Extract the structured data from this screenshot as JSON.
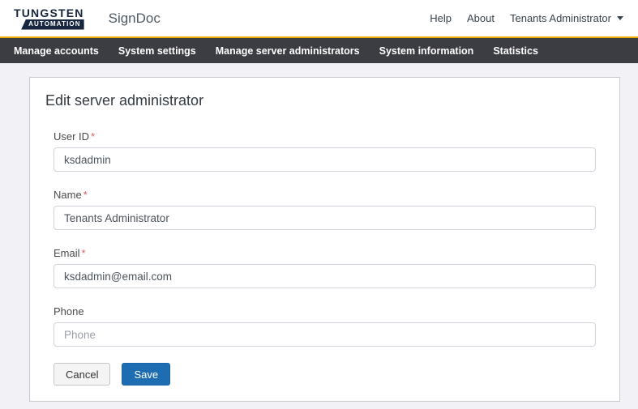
{
  "brand": {
    "logo_line1": "TUNGSTEN",
    "logo_line2": "AUTOMATION",
    "app_name": "SignDoc"
  },
  "header": {
    "links": [
      {
        "label": "Help"
      },
      {
        "label": "About"
      }
    ],
    "user_menu": {
      "label": "Tenants Administrator"
    }
  },
  "nav": {
    "items": [
      "Manage accounts",
      "System settings",
      "Manage server administrators",
      "System information",
      "Statistics"
    ]
  },
  "main": {
    "title": "Edit server administrator",
    "fields": [
      {
        "label": "User ID",
        "required_mark": "*",
        "value": "ksdadmin",
        "placeholder": ""
      },
      {
        "label": "Name",
        "required_mark": "*",
        "value": "Tenants Administrator",
        "placeholder": ""
      },
      {
        "label": "Email",
        "required_mark": "*",
        "value": "ksdadmin@email.com",
        "placeholder": ""
      },
      {
        "label": "Phone",
        "required_mark": "",
        "value": "",
        "placeholder": "Phone"
      }
    ],
    "buttons": {
      "cancel": "Cancel",
      "save": "Save"
    }
  },
  "colors": {
    "accent_gold": "#eeaa00",
    "nav_background": "#3c3c43",
    "brand_navy": "#17263e",
    "primary_button_blue": "#1e6db3",
    "required_red": "#e05c57",
    "page_background": "#f2f2f6"
  }
}
